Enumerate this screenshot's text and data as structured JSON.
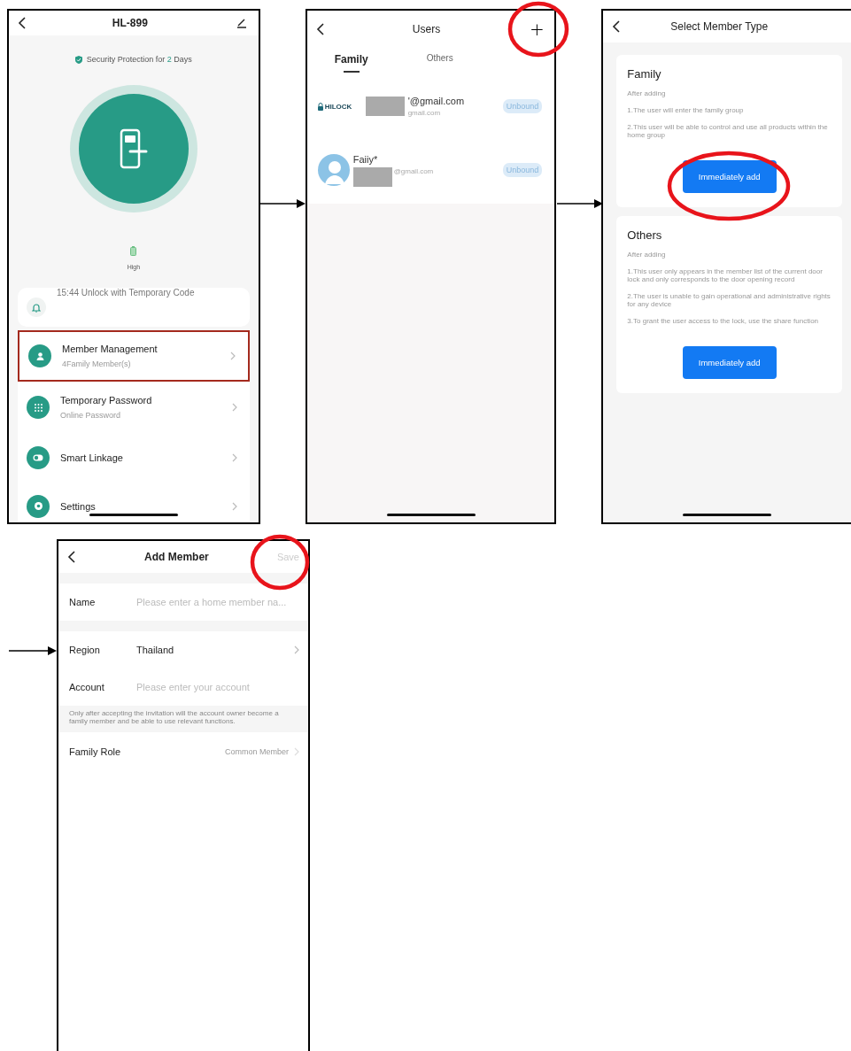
{
  "device_screen": {
    "title": "HL-899",
    "protection": {
      "before": "Security Protection for ",
      "days": "2",
      "after": " Days"
    },
    "battery": {
      "label": "High"
    },
    "items": [
      {
        "kind": "notice",
        "title": "15:44 Unlock with Temporary Code",
        "highlighted": false
      },
      {
        "kind": "menu",
        "title": "Member Management",
        "subtitle": "4Family Member(s)",
        "highlighted": true
      },
      {
        "kind": "menu",
        "title": "Temporary Password",
        "subtitle": "Online Password",
        "highlighted": false
      },
      {
        "kind": "menu",
        "title": "Smart Linkage",
        "highlighted": false
      },
      {
        "kind": "menu",
        "title": "Settings",
        "highlighted": false
      }
    ]
  },
  "users_screen": {
    "title": "Users",
    "add": {
      "label": "+",
      "circled": true
    },
    "tabs": [
      {
        "label": "Family",
        "selected": true
      },
      {
        "label": "Others",
        "selected": false
      }
    ],
    "users": [
      {
        "kind": "logo",
        "logo_text": "HILOCK",
        "email": "'@gmail.com",
        "sub": "gmail.com",
        "badge": "Unbound"
      },
      {
        "kind": "avatar",
        "name": "Faiiy*",
        "email": "@gmail.com",
        "badge": "Unbound"
      }
    ]
  },
  "member_type_screen": {
    "title": "Select Member Type",
    "cards": [
      {
        "title": "Family",
        "intro": "After adding",
        "lines": [
          "1.The user will enter the family group",
          "2.This user will be able to control and use all products within the home group"
        ],
        "button": "Immediately add",
        "circled": true
      },
      {
        "title": "Others",
        "intro": "After adding",
        "lines": [
          "1.This user only appears in the member list of the current door lock and only corresponds to the door opening record",
          "2.The user is unable to gain operational and administrative rights for any device",
          "3.To grant the user access to the lock, use the share function"
        ],
        "button": "Immediately add",
        "circled": false
      }
    ]
  },
  "add_member_screen": {
    "title": "Add Member",
    "save": {
      "label": "Save",
      "disabled": true,
      "circled": true
    },
    "name_row": {
      "label": "Name",
      "placeholder": "Please enter a home member na..."
    },
    "region_row": {
      "label": "Region",
      "value": "Thailand"
    },
    "account_row": {
      "label": "Account",
      "placeholder": "Please enter your account"
    },
    "note": "Only after accepting the invitation will the account owner become a family member and be able to use relevant functions.",
    "role_row": {
      "label": "Family Role",
      "value": "Common Member"
    }
  }
}
